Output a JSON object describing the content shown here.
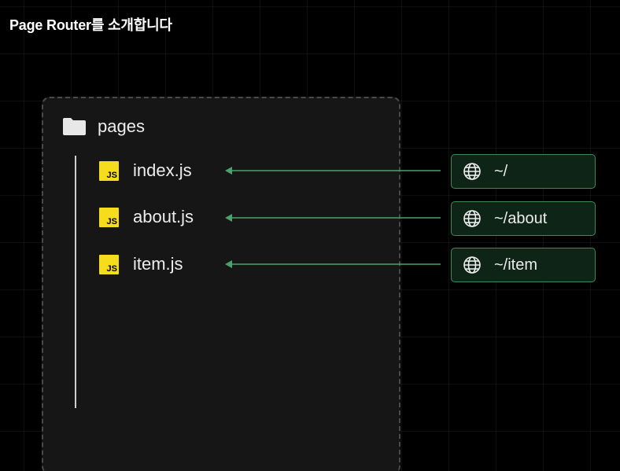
{
  "title": "Page Router를 소개합니다",
  "folder": {
    "label": "pages",
    "icon": "folder-icon"
  },
  "files": [
    {
      "label": "index.js",
      "icon_text": "JS"
    },
    {
      "label": "about.js",
      "icon_text": "JS"
    },
    {
      "label": "item.js",
      "icon_text": "JS"
    }
  ],
  "routes": [
    {
      "label": "~/",
      "icon": "globe-icon"
    },
    {
      "label": "~/about",
      "icon": "globe-icon"
    },
    {
      "label": "~/item",
      "icon": "globe-icon"
    }
  ],
  "colors": {
    "background": "#000000",
    "panel": "#161616",
    "js_yellow": "#f5dc1d",
    "route_bg": "#0e2416",
    "route_border": "#3f8a58",
    "arrow": "#4aa36a"
  }
}
